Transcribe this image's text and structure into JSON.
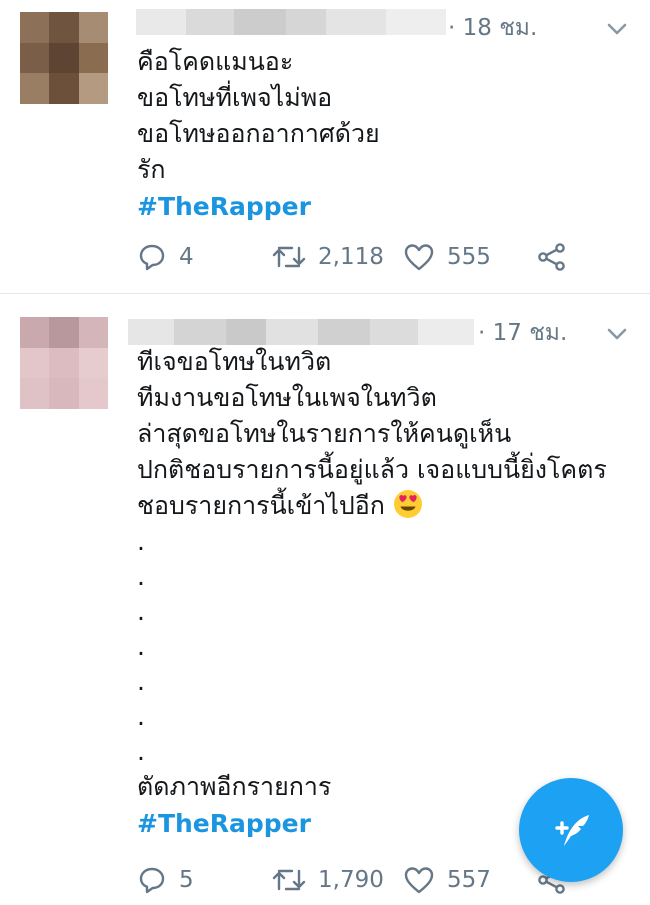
{
  "tweets": [
    {
      "timestamp": "· 18 ชม.",
      "lines": [
        "คือโคดแมนอะ",
        "ขอโทษที่เพจไม่พอ",
        "ขอโทษออกอากาศด้วย",
        "รัก"
      ],
      "hashtag": "#TheRapper",
      "reply_count": "4",
      "retweet_count": "2,118",
      "like_count": "555"
    },
    {
      "timestamp": "· 17 ชม.",
      "lines": [
        "ทีเจขอโทษในทวิต",
        "ทีมงานขอโทษในเพจในทวิต",
        "ล่าสุดขอโทษในรายการให้คนดูเห็น",
        "ปกติชอบรายการนี้อยู่แล้ว เจอแบบนี้ยิ่งโคตร",
        "ชอบรายการนี้เข้าไปอีก"
      ],
      "dots": [
        ".",
        ".",
        ".",
        ".",
        ".",
        ".",
        "."
      ],
      "final_line": "ตัดภาพอีกรายการ",
      "hashtag": "#TheRapper",
      "reply_count": "5",
      "retweet_count": "1,790",
      "like_count": "557"
    }
  ],
  "icons": {
    "reply": "reply-icon",
    "retweet": "retweet-icon",
    "like": "heart-icon",
    "share": "share-icon",
    "more": "chevron-down-icon",
    "compose": "compose-tweet-icon",
    "emoji": "heart-eyes-emoji"
  },
  "colors": {
    "hashtag": "#1b95e0",
    "meta_text": "#657786",
    "fab": "#1da1f2",
    "divider": "#e1e8ed"
  }
}
